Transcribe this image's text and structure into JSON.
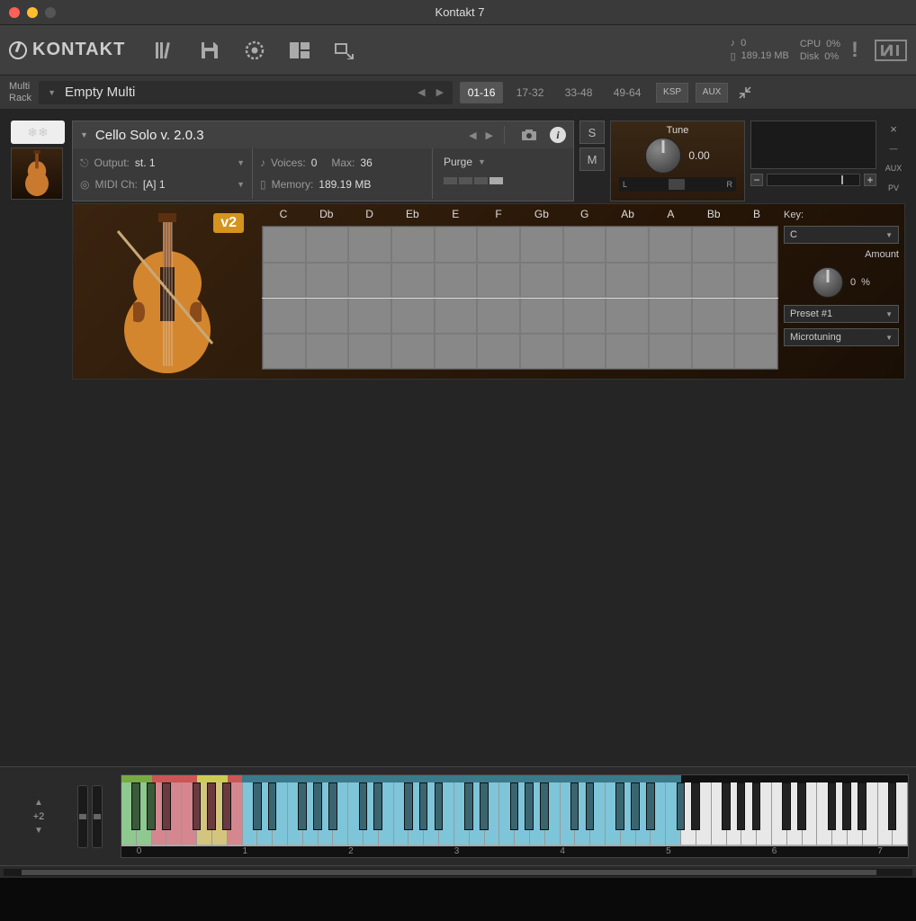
{
  "window": {
    "title": "Kontakt 7"
  },
  "toolbar": {
    "logo_text": "KONTAKT",
    "stats": {
      "voices_icon": "♪",
      "voices": "0",
      "mem_icon": "▯",
      "memory": "189.19 MB",
      "cpu_label": "CPU",
      "cpu": "0%",
      "disk_label": "Disk",
      "disk": "0%"
    }
  },
  "rack": {
    "label_line1": "Multi",
    "label_line2": "Rack",
    "multi_name": "Empty Multi",
    "ranges": [
      "01-16",
      "17-32",
      "33-48",
      "49-64"
    ],
    "active_range": 0,
    "ksp": "KSP",
    "aux": "AUX"
  },
  "instrument": {
    "name": "Cello Solo v. 2.0.3",
    "output_label": "Output:",
    "output": "st. 1",
    "midi_label": "MIDI Ch:",
    "midi": "[A]  1",
    "voices_label": "Voices:",
    "voices": "0",
    "max_label": "Max:",
    "max": "36",
    "memory_label": "Memory:",
    "memory": "189.19 MB",
    "purge": "Purge",
    "solo": "S",
    "mute": "M",
    "tune_label": "Tune",
    "tune": "0.00",
    "pan_l": "L",
    "pan_r": "R",
    "close_x": "×",
    "minus": "—",
    "aux": "AUX",
    "pv": "PV",
    "v2_badge": "v2",
    "notes": [
      "C",
      "Db",
      "D",
      "Eb",
      "E",
      "F",
      "Gb",
      "G",
      "Ab",
      "A",
      "Bb",
      "B"
    ],
    "key_label": "Key:",
    "key": "C",
    "amount_label": "Amount",
    "amount": "0",
    "amount_unit": "%",
    "preset": "Preset #1",
    "microtuning": "Microtuning"
  },
  "keyboard": {
    "octave_shift": "+2",
    "octave_labels": [
      "0",
      "1",
      "2",
      "3",
      "4",
      "5",
      "6",
      "7"
    ]
  }
}
